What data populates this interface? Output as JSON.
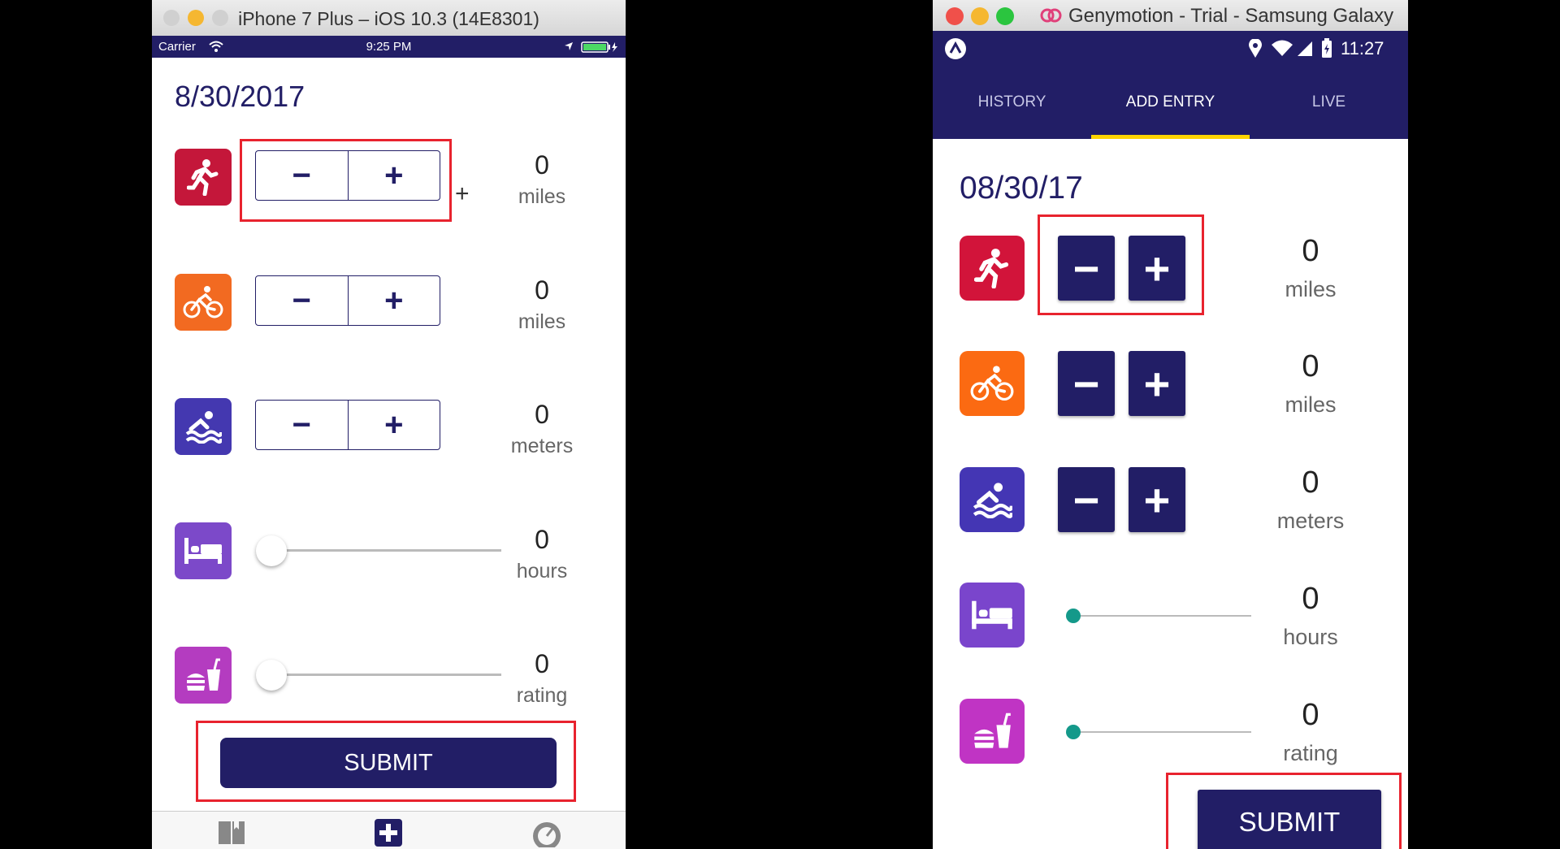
{
  "ios": {
    "window_title": "iPhone 7 Plus – iOS 10.3 (14E8301)",
    "status": {
      "carrier": "Carrier",
      "time": "9:25 PM"
    },
    "date": "8/30/2017",
    "rows": [
      {
        "icon": "running-icon",
        "color": "#c4173a",
        "value": "0",
        "unit": "miles"
      },
      {
        "icon": "bicycle-icon",
        "color": "#f26a21",
        "value": "0",
        "unit": "miles"
      },
      {
        "icon": "swimming-icon",
        "color": "#4438b0",
        "value": "0",
        "unit": "meters"
      },
      {
        "icon": "bed-icon",
        "color": "#7c49c9",
        "value": "0",
        "unit": "hours"
      },
      {
        "icon": "food-icon",
        "color": "#b43cc0",
        "value": "0",
        "unit": "rating"
      }
    ],
    "minus_label": "−",
    "plus_label": "+",
    "stray_plus": "+",
    "submit_label": "SUBMIT",
    "tab_icons": [
      "book-icon",
      "plus-square-icon",
      "dashboard-icon"
    ]
  },
  "android": {
    "window_title": "Genymotion - Trial - Samsung Galaxy",
    "status": {
      "time": "11:27"
    },
    "tabs": [
      {
        "label": "HISTORY"
      },
      {
        "label": "ADD ENTRY",
        "active": true
      },
      {
        "label": "LIVE"
      }
    ],
    "date": "08/30/17",
    "rows": [
      {
        "icon": "running-icon",
        "color": "#d2143a",
        "value": "0",
        "unit": "miles"
      },
      {
        "icon": "bicycle-icon",
        "color": "#fb6a12",
        "value": "0",
        "unit": "miles"
      },
      {
        "icon": "swimming-icon",
        "color": "#4436b4",
        "value": "0",
        "unit": "meters"
      },
      {
        "icon": "bed-icon",
        "color": "#7a45cc",
        "value": "0",
        "unit": "hours"
      },
      {
        "icon": "food-icon",
        "color": "#c034c4",
        "value": "0",
        "unit": "rating"
      }
    ],
    "minus_label": "−",
    "plus_label": "+",
    "submit_label": "SUBMIT",
    "accent": "#14998a"
  }
}
